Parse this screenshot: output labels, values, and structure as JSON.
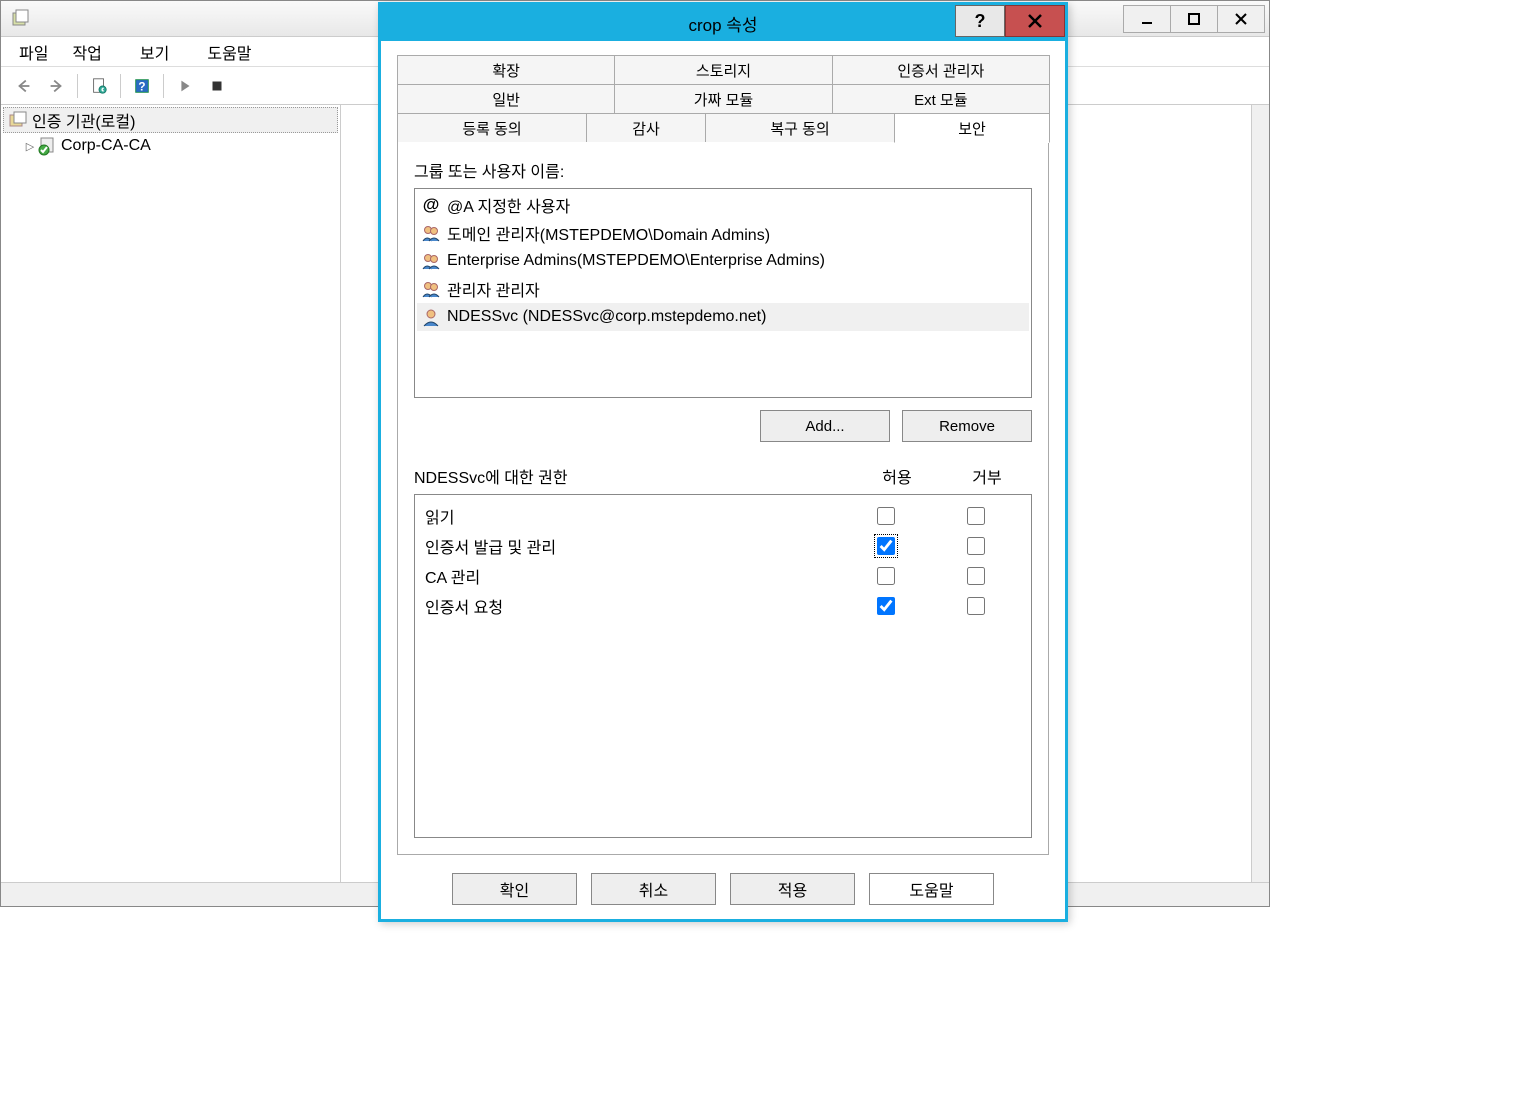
{
  "main_window": {
    "menubar": {
      "file": "파일",
      "action": "작업",
      "view": "보기",
      "help": "도움말"
    },
    "tree": {
      "root": "인증 기관(로컬)",
      "child": "Corp-CA-CA"
    }
  },
  "dialog": {
    "title": "crop 속성",
    "tabs": {
      "row1": [
        "확장",
        "스토리지",
        "인증서 관리자"
      ],
      "row2": [
        "일반",
        "가짜 모듈",
        "Ext 모듈"
      ],
      "row3": [
        "등록 동의",
        "감사",
        "복구 동의",
        "보안"
      ],
      "active": "보안"
    },
    "group_label": "그룹 또는 사용자 이름:",
    "principals": [
      {
        "icon": "at",
        "text": "@A 지정한 사용자"
      },
      {
        "icon": "group",
        "text": "도메인 관리자(MSTEPDEMO\\Domain Admins)"
      },
      {
        "icon": "group",
        "text": "Enterprise Admins(MSTEPDEMO\\Enterprise Admins)"
      },
      {
        "icon": "group",
        "text": "관리자 관리자"
      },
      {
        "icon": "user",
        "text": "NDESSvc (NDESSvc@corp.mstepdemo.net)",
        "selected": true
      }
    ],
    "add_label": "Add...",
    "remove_label": "Remove",
    "perm_for_label": "NDESSvc에 대한 권한",
    "allow_label": "허용",
    "deny_label": "거부",
    "permissions": [
      {
        "name": "읽기",
        "allow": false,
        "deny": false
      },
      {
        "name": "인증서 발급 및 관리",
        "allow": true,
        "deny": false,
        "focus": true
      },
      {
        "name": "CA 관리",
        "allow": false,
        "deny": false
      },
      {
        "name": "인증서 요청",
        "allow": true,
        "deny": false
      }
    ],
    "buttons": {
      "ok": "확인",
      "cancel": "취소",
      "apply": "적용",
      "help": "도움말"
    }
  }
}
